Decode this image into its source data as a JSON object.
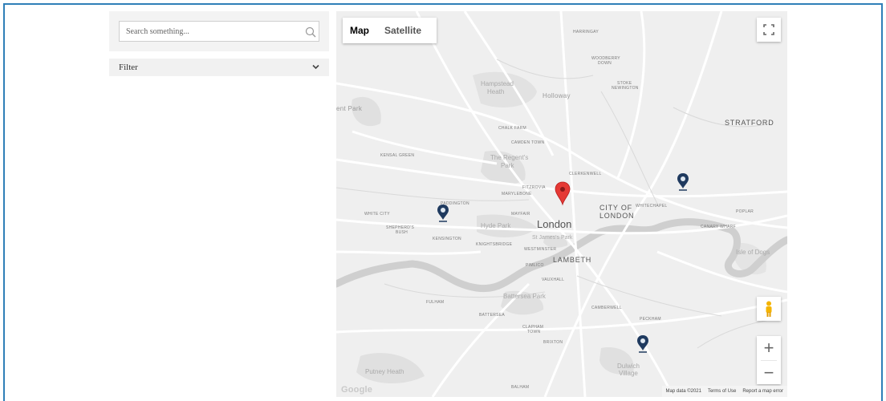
{
  "search": {
    "placeholder": "Search something..."
  },
  "filter": {
    "label": "Filter"
  },
  "map": {
    "type_buttons": {
      "map": "Map",
      "satellite": "Satellite"
    },
    "footer": {
      "map_data": "Map data ©2021",
      "terms": "Terms of Use",
      "report": "Report a map error"
    },
    "google_logo": "Google",
    "labels": {
      "stratford": "STRATFORD",
      "london": "London",
      "city_of_london_1": "CITY OF",
      "city_of_london_2": "LONDON",
      "lambeth": "LAMBETH",
      "holloway": "Holloway",
      "hampstead_1": "Hampstead",
      "hampstead_2": "Heath",
      "regents_1": "The Regent's",
      "regents_2": "Park",
      "hyde_park": "Hyde Park",
      "battersea_park": "Battersea Park",
      "dulwich_1": "Dulwich",
      "dulwich_2": "Village",
      "putney_heath": "Putney Heath",
      "harringay": "HARRINGAY",
      "woodberry_1": "WOODBERRY",
      "woodberry_2": "DOWN",
      "stoke_1": "STOKE",
      "stoke_2": "NEWINGTON",
      "chalk_farm": "CHALK FARM",
      "camden_town": "CAMDEN TOWN",
      "kensal_green": "KENSAL GREEN",
      "clerkenwell": "CLERKENWELL",
      "fitzrovia": "FITZROVIA",
      "marylebone": "MARYLEBONE",
      "paddington": "PADDINGTON",
      "mayfair": "MAYFAIR",
      "whitechapel": "WHITECHAPEL",
      "poplar": "POPLAR",
      "canary_wharf": "CANARY WHARF",
      "isle_of_dogs": "Isle of Dogs",
      "white_city": "WHITE CITY",
      "shepherds_1": "SHEPHERD'S",
      "shepherds_2": "BUSH",
      "kensington": "KENSINGTON",
      "knightsbridge": "KNIGHTSBRIDGE",
      "westminster": "WESTMINSTER",
      "st_james": "St James's Park",
      "pimlico": "PIMLICO",
      "vauxhall": "VAUXHALL",
      "fulham": "FULHAM",
      "battersea": "BATTERSEA",
      "clapham_1": "CLAPHAM",
      "clapham_2": "TOWN",
      "brixton": "BRIXTON",
      "camberwell": "CAMBERWELL",
      "peckham": "PECKHAM",
      "balham": "BALHAM",
      "brent_park": "ent Park"
    }
  },
  "colors": {
    "frame_border": "#2f7fb8",
    "marker_red": "#e53935",
    "marker_navy": "#1f3a5f",
    "map_bg": "#efefef"
  },
  "icons": [
    "search-icon",
    "chevron-down-icon",
    "fullscreen-icon",
    "pegman-icon",
    "zoom-in-icon",
    "zoom-out-icon",
    "map-marker-icon",
    "location-pin-icon"
  ]
}
